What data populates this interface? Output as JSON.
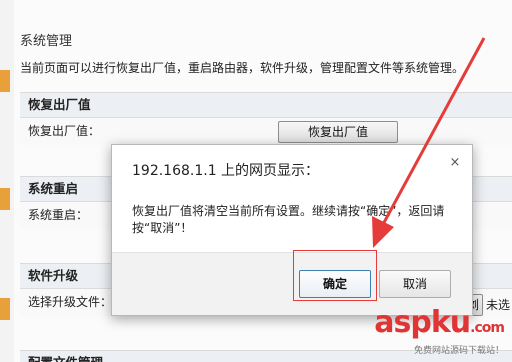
{
  "page": {
    "title": "系统管理",
    "description": "当前页面可以进行恢复出厂值，重启路由器，软件升级，管理配置文件等系统管理。"
  },
  "sections": {
    "factory_reset": {
      "heading": "恢复出厂值",
      "label": "恢复出厂值：",
      "button": "恢复出厂值"
    },
    "reboot": {
      "heading": "系统重启",
      "label": "系统重启："
    },
    "upgrade": {
      "heading": "软件升级",
      "label": "选择升级文件：",
      "browse_button": "浏",
      "status_text": "未选"
    },
    "config": {
      "heading": "配置文件管理"
    }
  },
  "dialog": {
    "title": "192.168.1.1 上的网页显示：",
    "close": "×",
    "message": "恢复出厂值将清空当前所有设置。继续请按“确定”，返回请按“取消”！",
    "ok": "确定",
    "cancel": "取消"
  },
  "watermark": {
    "logo": "aspku",
    "logo_suffix": ".com",
    "tagline": "免费网站源码下载站！"
  },
  "colors": {
    "annotation_red": "#e53b3b",
    "accent_orange": "#e8a13a",
    "watermark_red": "#e03535"
  },
  "icons": {
    "dialog_close": "close-icon",
    "annotation": "red-arrow"
  }
}
